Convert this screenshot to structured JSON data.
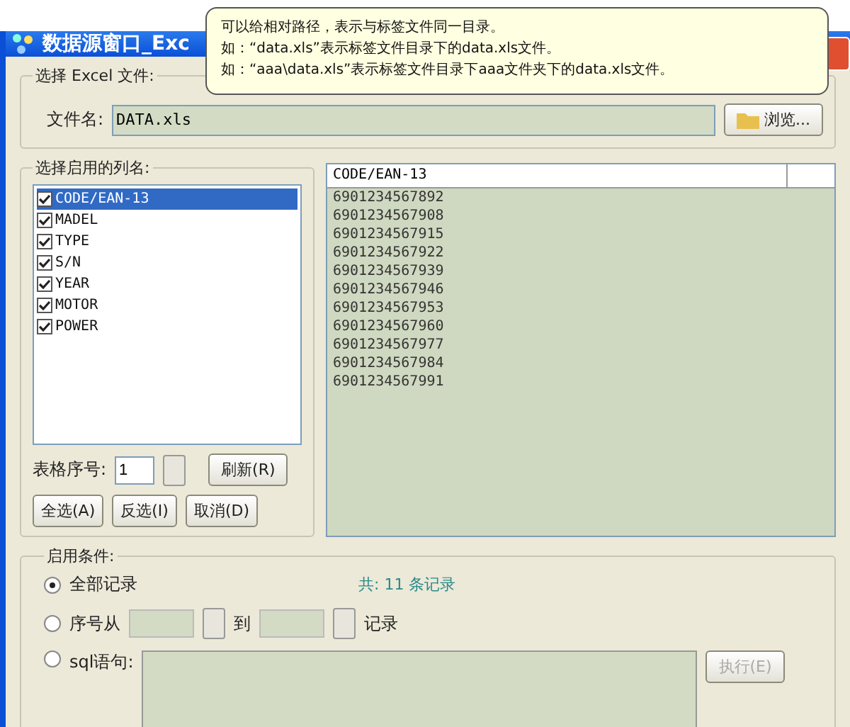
{
  "window": {
    "title": "数据源窗口_Exc"
  },
  "tooltip": {
    "lines": [
      "可以给相对路径，表示与标签文件同一目录。",
      "如：“data.xls”表示标签文件目录下的data.xls文件。",
      "如：“aaa\\data.xls”表示标签文件目录下aaa文件夹下的data.xls文件。"
    ]
  },
  "file_group": {
    "title": "选择 Excel 文件:",
    "file_label": "文件名:",
    "file_value": "DATA.xls",
    "browse_button": "浏览..."
  },
  "columns_group": {
    "title": "选择启用的列名:",
    "items": [
      {
        "label": "CODE/EAN-13",
        "checked": true,
        "selected": true
      },
      {
        "label": "MADEL",
        "checked": true,
        "selected": false
      },
      {
        "label": "TYPE",
        "checked": true,
        "selected": false
      },
      {
        "label": "S/N",
        "checked": true,
        "selected": false
      },
      {
        "label": "YEAR",
        "checked": true,
        "selected": false
      },
      {
        "label": "MOTOR",
        "checked": true,
        "selected": false
      },
      {
        "label": "POWER",
        "checked": true,
        "selected": false
      }
    ],
    "sheet_label": "表格序号:",
    "sheet_value": "1",
    "buttons": [
      "刷新(R)",
      "全选(A)",
      "反选(I)",
      "取消(D)"
    ]
  },
  "table": {
    "columns": [
      "CODE/EAN-13"
    ],
    "rows": [
      "6901234567892",
      "6901234567908",
      "6901234567915",
      "6901234567922",
      "6901234567939",
      "6901234567946",
      "6901234567953",
      "6901234567960",
      "6901234567977",
      "6901234567984",
      "6901234567991"
    ]
  },
  "conditions": {
    "title": "启用条件:",
    "options": [
      {
        "kind": "all",
        "label": "全部记录",
        "selected": true
      },
      {
        "kind": "range",
        "label": "序号从",
        "to_label": "到",
        "end_label": "记录",
        "selected": false
      },
      {
        "kind": "sql",
        "label": "sql语句:",
        "selected": false
      }
    ],
    "count": "共: 11 条记录",
    "execute_button": "执行(E)",
    "execute_disabled": true
  }
}
